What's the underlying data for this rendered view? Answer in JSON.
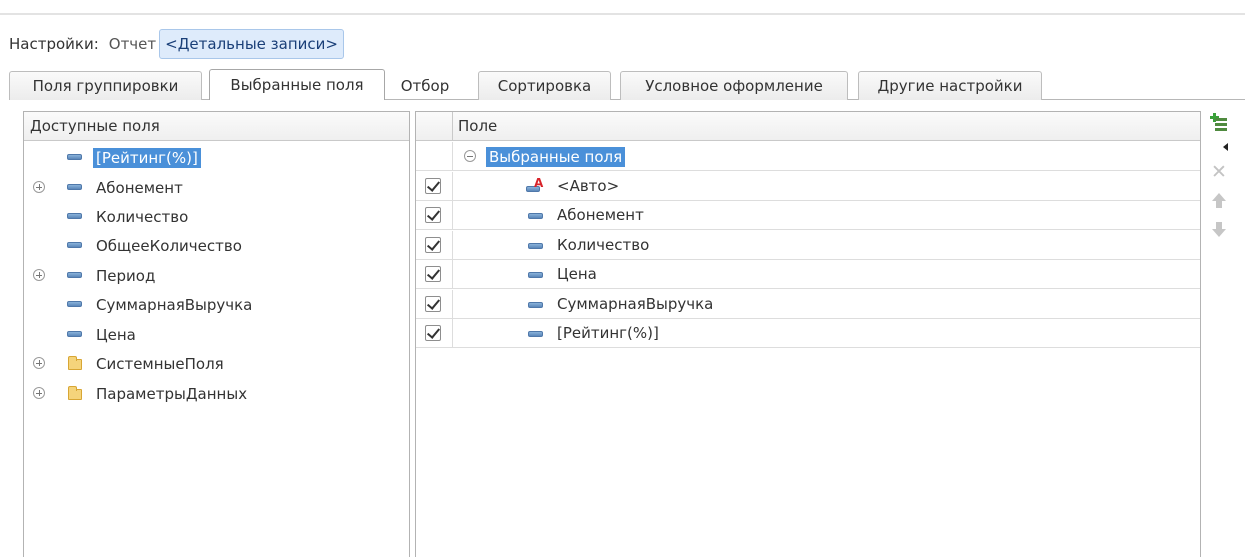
{
  "settings": {
    "label": "Настройки:",
    "report_label": "Отчет",
    "report_value": "<Детальные записи>"
  },
  "tabs": [
    {
      "label": "Поля группировки"
    },
    {
      "label": "Выбранные поля"
    },
    {
      "label": "Отбор"
    },
    {
      "label": "Сортировка"
    },
    {
      "label": "Условное оформление"
    },
    {
      "label": "Другие настройки"
    }
  ],
  "available": {
    "header": "Доступные поля",
    "items": [
      {
        "label": "[Рейтинг(%)]",
        "icon": "field-icon",
        "expandable": false,
        "selected": true
      },
      {
        "label": "Абонемент",
        "icon": "field-icon",
        "expandable": true
      },
      {
        "label": "Количество",
        "icon": "field-icon",
        "expandable": false
      },
      {
        "label": "ОбщееКоличество",
        "icon": "field-icon",
        "expandable": false
      },
      {
        "label": "Период",
        "icon": "field-icon",
        "expandable": true
      },
      {
        "label": "СуммарнаяВыручка",
        "icon": "field-icon",
        "expandable": false
      },
      {
        "label": "Цена",
        "icon": "field-icon",
        "expandable": false
      },
      {
        "label": "СистемныеПоля",
        "icon": "folder-icon",
        "expandable": true
      },
      {
        "label": "ПараметрыДанных",
        "icon": "folder-icon",
        "expandable": true
      }
    ]
  },
  "selected": {
    "header": "Поле",
    "group_label": "Выбранные поля",
    "items": [
      {
        "label": "<Авто>",
        "icon": "auto-field-icon",
        "checked": true
      },
      {
        "label": "Абонемент",
        "icon": "field-icon",
        "checked": true
      },
      {
        "label": "Количество",
        "icon": "field-icon",
        "checked": true
      },
      {
        "label": "Цена",
        "icon": "field-icon",
        "checked": true
      },
      {
        "label": "СуммарнаяВыручка",
        "icon": "field-icon",
        "checked": true
      },
      {
        "label": "[Рейтинг(%)]",
        "icon": "field-icon",
        "checked": true
      }
    ]
  },
  "toolbar": {
    "add": "add-field-icon",
    "delete": "delete-icon",
    "move_up": "move-up-icon",
    "move_down": "move-down-icon"
  },
  "colors": {
    "selection": "#4a90d9",
    "chip_bg": "#deebfb",
    "add_green": "#3aa13a"
  }
}
